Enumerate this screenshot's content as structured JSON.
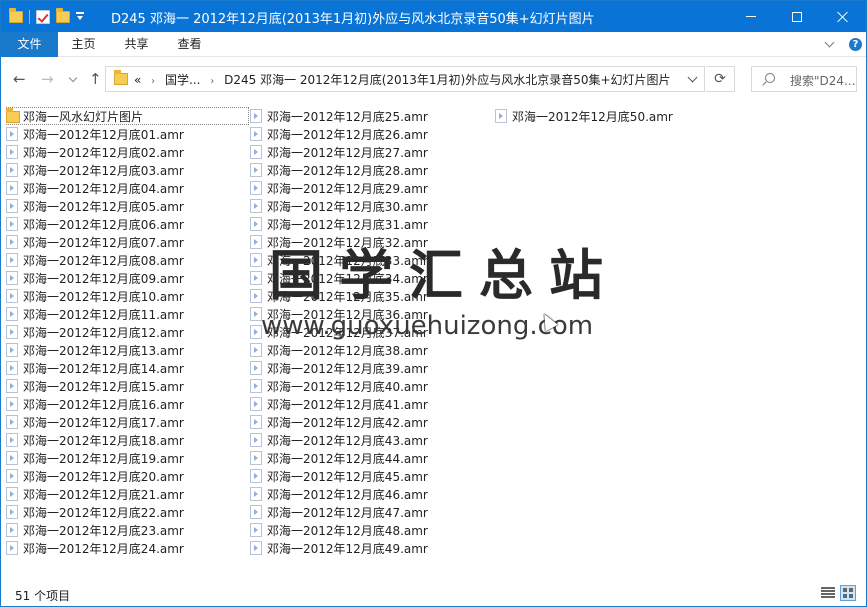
{
  "window": {
    "title": "D245 邓海一 2012年12月底(2013年1月初)外应与风水北京录音50集+幻灯片图片"
  },
  "ribbon": {
    "tabs": [
      "文件",
      "主页",
      "共享",
      "查看"
    ]
  },
  "address": {
    "overflow": "«",
    "crumbs": [
      "国学...",
      "D245 邓海一 2012年12月底(2013年1月初)外应与风水北京录音50集+幻灯片图片"
    ]
  },
  "search": {
    "placeholder": "搜索\"D24..."
  },
  "files": {
    "column1": [
      {
        "name": "邓海一风水幻灯片图片",
        "type": "folder"
      },
      {
        "name": "邓海一2012年12月底01.amr",
        "type": "file"
      },
      {
        "name": "邓海一2012年12月底02.amr",
        "type": "file"
      },
      {
        "name": "邓海一2012年12月底03.amr",
        "type": "file"
      },
      {
        "name": "邓海一2012年12月底04.amr",
        "type": "file"
      },
      {
        "name": "邓海一2012年12月底05.amr",
        "type": "file"
      },
      {
        "name": "邓海一2012年12月底06.amr",
        "type": "file"
      },
      {
        "name": "邓海一2012年12月底07.amr",
        "type": "file"
      },
      {
        "name": "邓海一2012年12月底08.amr",
        "type": "file"
      },
      {
        "name": "邓海一2012年12月底09.amr",
        "type": "file"
      },
      {
        "name": "邓海一2012年12月底10.amr",
        "type": "file"
      },
      {
        "name": "邓海一2012年12月底11.amr",
        "type": "file"
      },
      {
        "name": "邓海一2012年12月底12.amr",
        "type": "file"
      },
      {
        "name": "邓海一2012年12月底13.amr",
        "type": "file"
      },
      {
        "name": "邓海一2012年12月底14.amr",
        "type": "file"
      },
      {
        "name": "邓海一2012年12月底15.amr",
        "type": "file"
      },
      {
        "name": "邓海一2012年12月底16.amr",
        "type": "file"
      },
      {
        "name": "邓海一2012年12月底17.amr",
        "type": "file"
      },
      {
        "name": "邓海一2012年12月底18.amr",
        "type": "file"
      },
      {
        "name": "邓海一2012年12月底19.amr",
        "type": "file"
      },
      {
        "name": "邓海一2012年12月底20.amr",
        "type": "file"
      },
      {
        "name": "邓海一2012年12月底21.amr",
        "type": "file"
      },
      {
        "name": "邓海一2012年12月底22.amr",
        "type": "file"
      },
      {
        "name": "邓海一2012年12月底23.amr",
        "type": "file"
      },
      {
        "name": "邓海一2012年12月底24.amr",
        "type": "file"
      }
    ],
    "column2": [
      {
        "name": "邓海一2012年12月底25.amr",
        "type": "file"
      },
      {
        "name": "邓海一2012年12月底26.amr",
        "type": "file"
      },
      {
        "name": "邓海一2012年12月底27.amr",
        "type": "file"
      },
      {
        "name": "邓海一2012年12月底28.amr",
        "type": "file"
      },
      {
        "name": "邓海一2012年12月底29.amr",
        "type": "file"
      },
      {
        "name": "邓海一2012年12月底30.amr",
        "type": "file"
      },
      {
        "name": "邓海一2012年12月底31.amr",
        "type": "file"
      },
      {
        "name": "邓海一2012年12月底32.amr",
        "type": "file"
      },
      {
        "name": "邓海一2012年12月底33.amr",
        "type": "file"
      },
      {
        "name": "邓海一2012年12月底34.amr",
        "type": "file"
      },
      {
        "name": "邓海一2012年12月底35.amr",
        "type": "file"
      },
      {
        "name": "邓海一2012年12月底36.amr",
        "type": "file"
      },
      {
        "name": "邓海一2012年12月底37.amr",
        "type": "file"
      },
      {
        "name": "邓海一2012年12月底38.amr",
        "type": "file"
      },
      {
        "name": "邓海一2012年12月底39.amr",
        "type": "file"
      },
      {
        "name": "邓海一2012年12月底40.amr",
        "type": "file"
      },
      {
        "name": "邓海一2012年12月底41.amr",
        "type": "file"
      },
      {
        "name": "邓海一2012年12月底42.amr",
        "type": "file"
      },
      {
        "name": "邓海一2012年12月底43.amr",
        "type": "file"
      },
      {
        "name": "邓海一2012年12月底44.amr",
        "type": "file"
      },
      {
        "name": "邓海一2012年12月底45.amr",
        "type": "file"
      },
      {
        "name": "邓海一2012年12月底46.amr",
        "type": "file"
      },
      {
        "name": "邓海一2012年12月底47.amr",
        "type": "file"
      },
      {
        "name": "邓海一2012年12月底48.amr",
        "type": "file"
      },
      {
        "name": "邓海一2012年12月底49.amr",
        "type": "file"
      }
    ],
    "column3": [
      {
        "name": "邓海一2012年12月底50.amr",
        "type": "file"
      }
    ]
  },
  "watermark": {
    "chars": "国学汇总站",
    "url": "www.guoxuehuizong.com"
  },
  "status": {
    "count": "51 个项目"
  },
  "icons": {
    "folder": "folder-icon",
    "file": "audio-file-icon",
    "refresh": "refresh-icon",
    "search": "search-icon"
  },
  "colors": {
    "titlebar": "#0a74d6",
    "file_tab": "#1979ca",
    "folder": "#f6cc52"
  }
}
